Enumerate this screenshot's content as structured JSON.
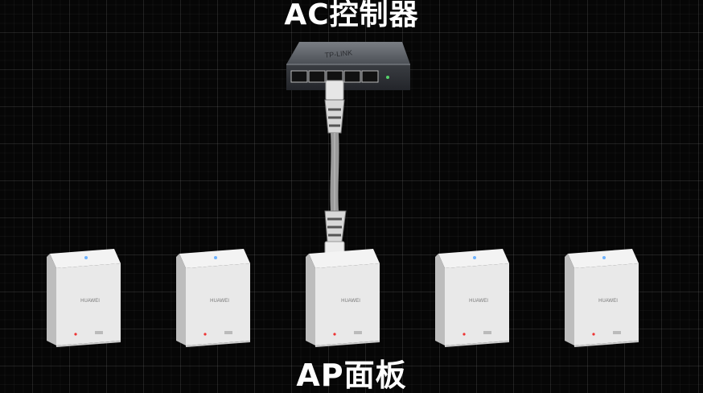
{
  "diagram": {
    "controller_label": "AC控制器",
    "panel_label": "AP面板",
    "caption": "",
    "switch": {
      "brand": "TP-LINK",
      "port_count": 5
    },
    "panels": [
      {
        "id": "ap-1",
        "brand": "HUAWEI"
      },
      {
        "id": "ap-2",
        "brand": "HUAWEI"
      },
      {
        "id": "ap-3",
        "brand": "HUAWEI",
        "connected": true
      },
      {
        "id": "ap-4",
        "brand": "HUAWEI"
      },
      {
        "id": "ap-5",
        "brand": "HUAWEI"
      }
    ],
    "colors": {
      "background": "#060606",
      "grid": "#2a2a2a",
      "text": "#ffffff",
      "cable": "#c9c9c9"
    }
  }
}
